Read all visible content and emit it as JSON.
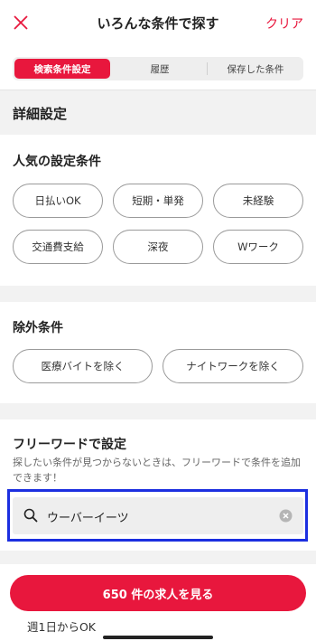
{
  "header": {
    "title": "いろんな条件で探す",
    "clear_label": "クリア"
  },
  "tabs": [
    "検索条件設定",
    "履歴",
    "保存した条件"
  ],
  "active_tab": 0,
  "details_title": "詳細設定",
  "popular": {
    "title": "人気の設定条件",
    "chips": [
      "日払いOK",
      "短期・単発",
      "未経験",
      "交通費支給",
      "深夜",
      "Wワーク"
    ]
  },
  "exclusion": {
    "title": "除外条件",
    "chips": [
      "医療バイトを除く",
      "ナイトワークを除く"
    ]
  },
  "freeword": {
    "title": "フリーワードで設定",
    "description": "探したい条件が見つからないときは、フリーワードで条件を追加できます！",
    "value": "ウーバーイーツ"
  },
  "cta_label": "650 件の求人を見る",
  "peek_text": "週1日からOK",
  "colors": {
    "accent": "#e8173d",
    "highlight_border": "#1c2fe0"
  },
  "icons": {
    "close": "close-icon",
    "search": "search-icon",
    "clear": "clear-input-icon"
  }
}
